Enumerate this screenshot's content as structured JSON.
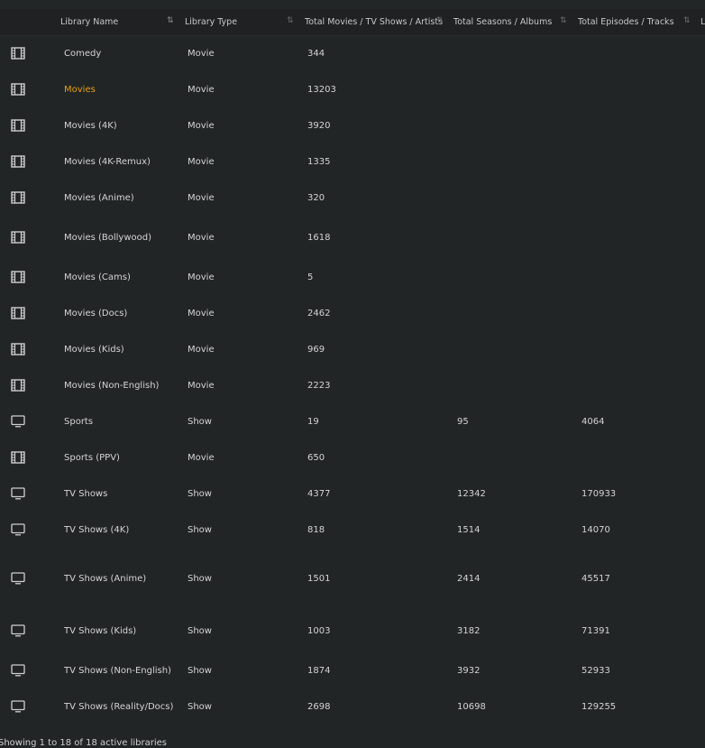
{
  "table": {
    "headers": [
      {
        "label": "Library Name",
        "sort": "asc"
      },
      {
        "label": "Library Type",
        "sort": "none"
      },
      {
        "label": "Total Movies / TV Shows / Artists",
        "sort": "none"
      },
      {
        "label": "Total Seasons / Albums",
        "sort": "none"
      },
      {
        "label": "Total Episodes / Tracks",
        "sort": "none"
      },
      {
        "label": "L",
        "sort": "none"
      }
    ],
    "rows": [
      {
        "icon": "film-icon",
        "name": "Comedy",
        "type": "Movie",
        "items": "344",
        "seasons": "",
        "episodes": ""
      },
      {
        "icon": "film-icon",
        "name": "Movies",
        "type": "Movie",
        "items": "13203",
        "seasons": "",
        "episodes": "",
        "highlight": true
      },
      {
        "icon": "film-icon",
        "name": "Movies (4K)",
        "type": "Movie",
        "items": "3920",
        "seasons": "",
        "episodes": ""
      },
      {
        "icon": "film-icon",
        "name": "Movies (4K-Remux)",
        "type": "Movie",
        "items": "1335",
        "seasons": "",
        "episodes": ""
      },
      {
        "icon": "film-icon",
        "name": "Movies (Anime)",
        "type": "Movie",
        "items": "320",
        "seasons": "",
        "episodes": ""
      },
      {
        "icon": "film-icon",
        "name": "Movies (Bollywood)",
        "type": "Movie",
        "items": "1618",
        "seasons": "",
        "episodes": ""
      },
      {
        "icon": "film-icon",
        "name": "Movies (Cams)",
        "type": "Movie",
        "items": "5",
        "seasons": "",
        "episodes": ""
      },
      {
        "icon": "film-icon",
        "name": "Movies (Docs)",
        "type": "Movie",
        "items": "2462",
        "seasons": "",
        "episodes": ""
      },
      {
        "icon": "film-icon",
        "name": "Movies (Kids)",
        "type": "Movie",
        "items": "969",
        "seasons": "",
        "episodes": ""
      },
      {
        "icon": "film-icon",
        "name": "Movies (Non-English)",
        "type": "Movie",
        "items": "2223",
        "seasons": "",
        "episodes": ""
      },
      {
        "icon": "tv-icon",
        "name": "Sports",
        "type": "Show",
        "items": "19",
        "seasons": "95",
        "episodes": "4064"
      },
      {
        "icon": "film-icon",
        "name": "Sports (PPV)",
        "type": "Movie",
        "items": "650",
        "seasons": "",
        "episodes": ""
      },
      {
        "icon": "tv-icon",
        "name": "TV Shows",
        "type": "Show",
        "items": "4377",
        "seasons": "12342",
        "episodes": "170933"
      },
      {
        "icon": "tv-icon",
        "name": "TV Shows (4K)",
        "type": "Show",
        "items": "818",
        "seasons": "1514",
        "episodes": "14070"
      },
      {
        "icon": "tv-icon",
        "name": "TV Shows (Anime)",
        "type": "Show",
        "items": "1501",
        "seasons": "2414",
        "episodes": "45517"
      },
      {
        "icon": "tv-icon",
        "name": "TV Shows (Kids)",
        "type": "Show",
        "items": "1003",
        "seasons": "3182",
        "episodes": "71391"
      },
      {
        "icon": "tv-icon",
        "name": "TV Shows (Non-English)",
        "type": "Show",
        "items": "1874",
        "seasons": "3932",
        "episodes": "52933"
      },
      {
        "icon": "tv-icon",
        "name": "TV Shows (Reality/Docs)",
        "type": "Show",
        "items": "2698",
        "seasons": "10698",
        "episodes": "129255"
      }
    ]
  },
  "footer": {
    "text": "Showing 1 to 18 of 18 active libraries"
  },
  "colors": {
    "background": "#222526",
    "header": "#1f2122",
    "accent": "#e5a00d",
    "text": "#d4d4d4"
  }
}
